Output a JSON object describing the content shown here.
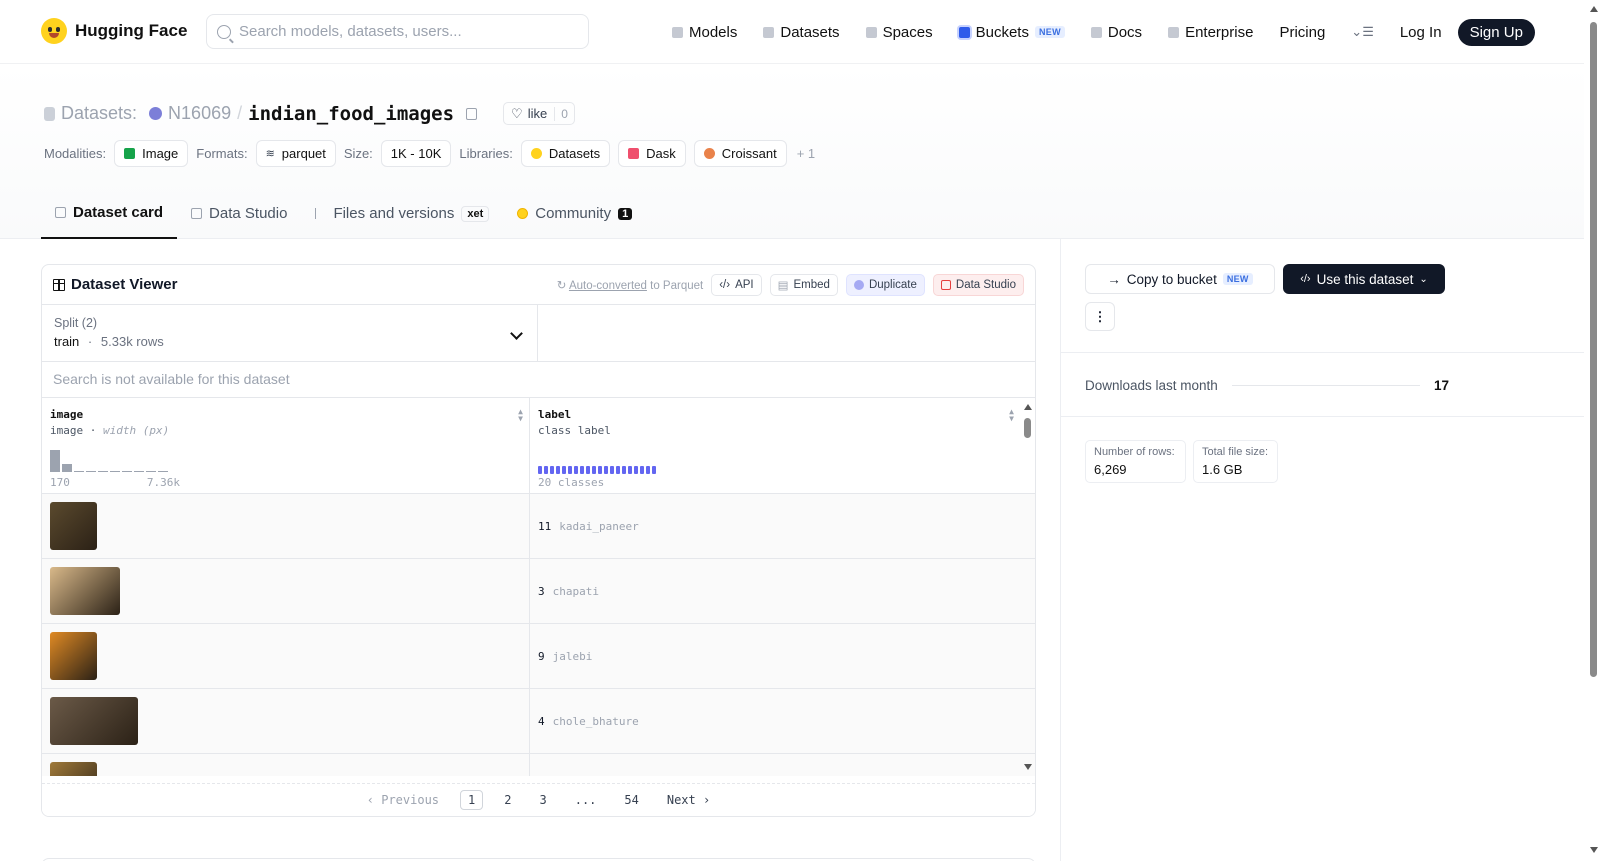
{
  "nav": {
    "logo": "Hugging Face",
    "search_placeholder": "Search models, datasets, users...",
    "links": [
      {
        "label": "Models",
        "icon": "cube-icon"
      },
      {
        "label": "Datasets",
        "icon": "database-icon"
      },
      {
        "label": "Spaces",
        "icon": "grid-icon"
      },
      {
        "label": "Buckets",
        "icon": "bucket-icon",
        "badge": "NEW"
      },
      {
        "label": "Docs",
        "icon": "book-icon"
      },
      {
        "label": "Enterprise",
        "icon": "enterprise-icon"
      },
      {
        "label": "Pricing"
      }
    ],
    "login": "Log In",
    "signup": "Sign Up"
  },
  "header": {
    "section": "Datasets:",
    "owner": "N16069",
    "separator": "/",
    "dataset_name": "indian_food_images",
    "like_label": "like",
    "like_count": "0",
    "modalities_label": "Modalities:",
    "modality": "Image",
    "formats_label": "Formats:",
    "format": "parquet",
    "size_label": "Size:",
    "size": "1K - 10K",
    "libraries_label": "Libraries:",
    "libraries": [
      "Datasets",
      "Dask",
      "Croissant"
    ],
    "more_libraries": "+ 1"
  },
  "tabs": [
    {
      "label": "Dataset card",
      "active": true
    },
    {
      "label": "Data Studio"
    },
    {
      "label": "Files and versions",
      "badge": "xet"
    },
    {
      "label": "Community",
      "count": "1"
    }
  ],
  "viewer": {
    "title": "Dataset Viewer",
    "autoconverted_link": "Auto-converted",
    "autoconverted_suffix": "to Parquet",
    "api": "API",
    "embed": "Embed",
    "duplicate": "Duplicate",
    "data_studio": "Data Studio",
    "split_label": "Split (2)",
    "split_value": "train",
    "split_sep": "·",
    "split_rows": "5.33k rows",
    "search_note": "Search is not available for this dataset",
    "columns": [
      {
        "name": "image",
        "type": "image",
        "subtype": "width (px)",
        "min": "170",
        "max": "7.36k",
        "hist": [
          0.9,
          0.35,
          0,
          0,
          0,
          0,
          0,
          0,
          0,
          0
        ]
      },
      {
        "name": "label",
        "type": "class label",
        "classes": "20 classes"
      }
    ],
    "rows": [
      {
        "label_id": "11",
        "label_name": "kadai_paneer",
        "thumb_color": "#5b4a2e",
        "thumb_w": 47
      },
      {
        "label_id": "3",
        "label_name": "chapati",
        "thumb_color": "#d9b98a",
        "thumb_w": 70
      },
      {
        "label_id": "9",
        "label_name": "jalebi",
        "thumb_color": "#e08a24",
        "thumb_w": 47
      },
      {
        "label_id": "4",
        "label_name": "chole_bhature",
        "thumb_color": "#6b5a48",
        "thumb_w": 88
      },
      {
        "label_id": "",
        "label_name": "",
        "thumb_color": "#a07a3a",
        "thumb_w": 47
      }
    ],
    "pager": {
      "prev": "Previous",
      "pages": [
        "1",
        "2",
        "3",
        "...",
        "54"
      ],
      "current": "1",
      "next": "Next"
    }
  },
  "sidebar": {
    "copy_to_bucket": "Copy to bucket",
    "copy_badge": "NEW",
    "use_dataset": "Use this dataset",
    "more": "⋮",
    "downloads_label": "Downloads last month",
    "downloads_value": "17",
    "rows_label": "Number of rows:",
    "rows_value": "6,269",
    "filesize_label": "Total file size:",
    "filesize_value": "1.6 GB"
  },
  "colors": {
    "accent_dark": "#111827",
    "class_bar": "#6366f1",
    "new_badge": "#3b6fe0"
  }
}
